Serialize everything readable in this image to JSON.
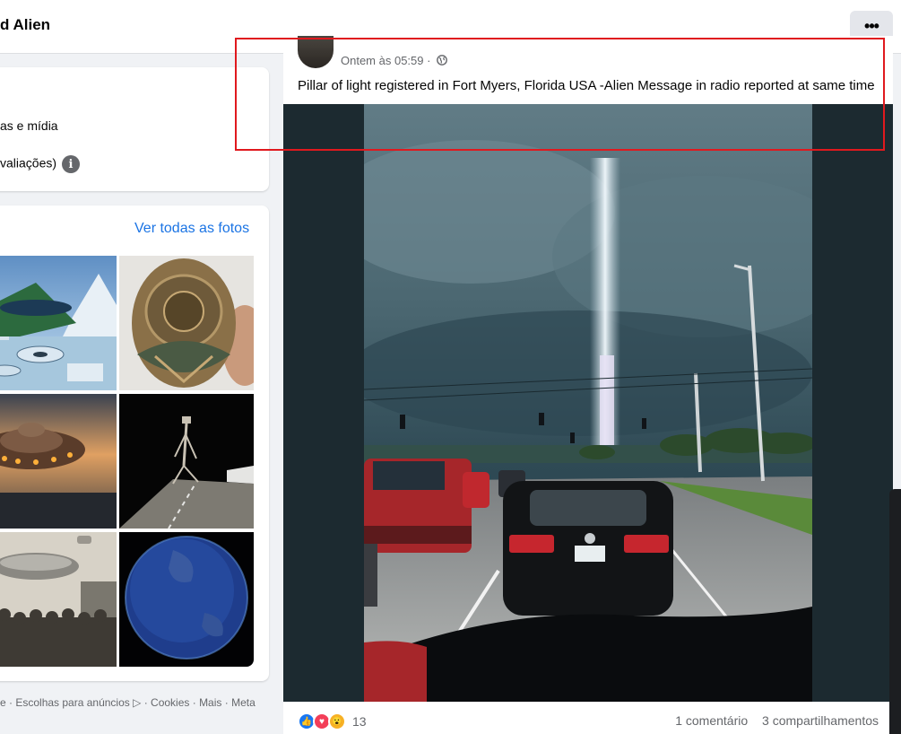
{
  "header": {
    "page_name": "d Alien",
    "more_label": "•••"
  },
  "intro": {
    "line1": "as e mídia",
    "line2": "valiações)",
    "info_glyph": "i"
  },
  "photos": {
    "see_all": "Ver todas as fotos",
    "tiles": [
      {
        "name": "photo-alien-mountain-landscape"
      },
      {
        "name": "photo-carved-artifact"
      },
      {
        "name": "photo-ufo-sunset"
      },
      {
        "name": "photo-tall-creature-road"
      },
      {
        "name": "photo-vintage-ufo-crowd"
      },
      {
        "name": "photo-earth-globe"
      }
    ]
  },
  "footer": {
    "items": [
      "e",
      "Escolhas para anúncios",
      "Cookies",
      "Mais",
      "Meta"
    ],
    "separator": " · ",
    "ad_choices_glyph": "▷"
  },
  "post": {
    "timestamp": "Ontem às 05:59 ·",
    "text": "Pillar of light registered in Fort Myers, Florida USA -Alien Message in radio reported at same time",
    "reaction_count": "13",
    "comments": "1 comentário",
    "shares": "3 compartilhamentos"
  },
  "colors": {
    "link": "#1b74e4",
    "highlight": "#e0191e",
    "like": "#1877f2",
    "love": "#f33e58",
    "wow": "#f7b125"
  }
}
